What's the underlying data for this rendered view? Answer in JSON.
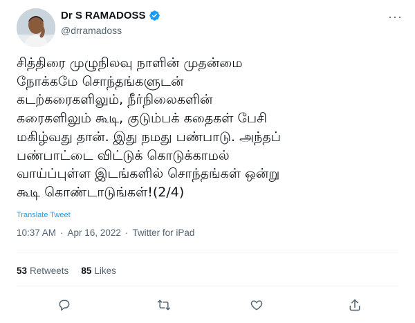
{
  "author": {
    "display_name": "Dr S RAMADOSS",
    "handle": "@drramadoss",
    "verified": true,
    "avatar_icon": "user-avatar"
  },
  "tweet": {
    "text": "சித்திரை முழுநிலவு நாளின் முதன்மை\nநோக்கமே சொந்தங்களுடன்\nகடற்கரைகளிலும், நீர்நிலைகளின்\nகரைகளிலும் கூடி, குடும்பக் கதைகள் பேசி\nமகிழ்வது தான். இது நமது பண்பாடு. அந்தப்\nபண்பாட்டை விட்டுக் கொடுக்காமல்\nவாய்ப்புள்ள இடங்களில் சொந்தங்கள் ஒன்று\nகூடி கொண்டாடுங்கள்!(2/4)",
    "translate_label": "Translate Tweet",
    "time": "10:37 AM",
    "separator": "·",
    "date": "Apr 16, 2022",
    "source": "Twitter for iPad"
  },
  "stats": {
    "retweets_count": "53",
    "retweets_label": "Retweets",
    "likes_count": "85",
    "likes_label": "Likes"
  },
  "icons": {
    "more": "more-icon",
    "reply": "reply-icon",
    "retweet": "retweet-icon",
    "like": "like-icon",
    "share": "share-icon",
    "verified": "verified-icon"
  },
  "colors": {
    "accent": "#1d9bf0",
    "text": "#0f1419",
    "muted": "#536471",
    "divider": "#eff3f4"
  }
}
